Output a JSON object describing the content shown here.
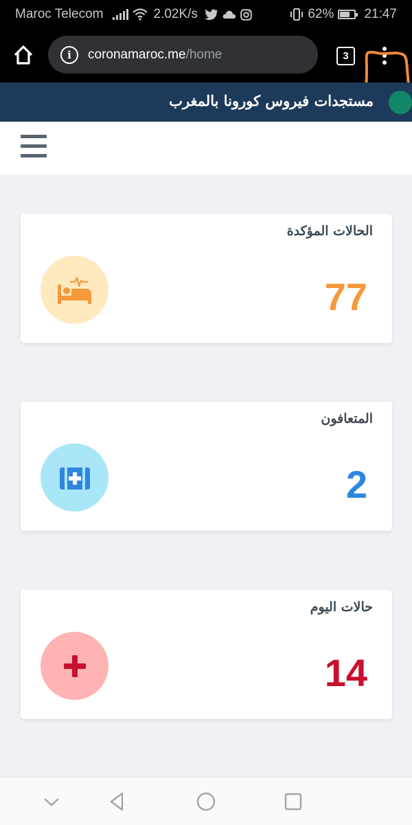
{
  "status_bar": {
    "carrier": "Maroc Telecom",
    "speed": "2.02K/s",
    "battery": "62%",
    "time": "21:47"
  },
  "browser": {
    "url_host": "coronamaroc.me",
    "url_path": "/home",
    "tab_count": "3"
  },
  "site": {
    "title": "مستجدات فيروس كورونا بالمغرب",
    "title_color": "#1e3a5a",
    "dot_color": "#13876a"
  },
  "cards": [
    {
      "label": "الحالات المؤكدة",
      "value": "77",
      "value_color": "#f5993a",
      "icon": "hospital-bed-icon",
      "icon_bg": "#ffe9bf",
      "icon_color": "#f5993a"
    },
    {
      "label": "المتعافون",
      "value": "2",
      "value_color": "#2e86de",
      "icon": "medical-kit-icon",
      "icon_bg": "#a9e6f7",
      "icon_color": "#2e86de"
    },
    {
      "label": "حالات اليوم",
      "value": "14",
      "value_color": "#c8102e",
      "icon": "plus-icon",
      "icon_bg": "#ffb3b3",
      "icon_color": "#c8102e"
    }
  ]
}
